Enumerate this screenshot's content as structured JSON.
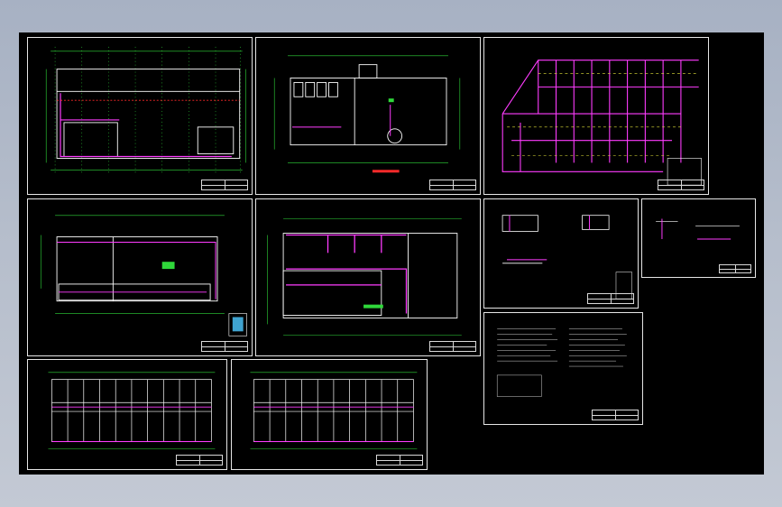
{
  "viewer": {
    "title": "",
    "sheet_count": 10
  },
  "colors": {
    "background": "#000000",
    "border": "#e6e6e6",
    "grid": "#2fd83a",
    "pipe": "#ff3cff",
    "wall": "#ffffff",
    "accent_red": "#ff2a2a",
    "accent_yellow": "#e8e83a"
  },
  "sheets": [
    {
      "id": "s1",
      "type": "plan"
    },
    {
      "id": "s2",
      "type": "plan"
    },
    {
      "id": "s3",
      "type": "iso"
    },
    {
      "id": "s4",
      "type": "plan"
    },
    {
      "id": "s5",
      "type": "plan"
    },
    {
      "id": "s6",
      "type": "detail"
    },
    {
      "id": "s7",
      "type": "detail"
    },
    {
      "id": "s8",
      "type": "notes"
    },
    {
      "id": "s9",
      "type": "dorm"
    },
    {
      "id": "s10",
      "type": "dorm"
    }
  ]
}
